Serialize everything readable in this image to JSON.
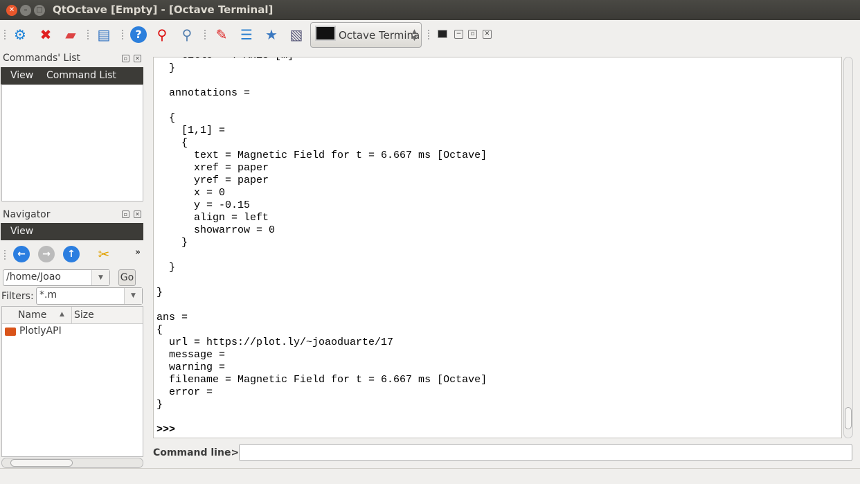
{
  "window": {
    "title": "QtOctave [Empty] - [Octave Terminal]"
  },
  "toolbar": {
    "icons": [
      "settings-icon",
      "stop-icon",
      "clear-icon",
      "table-icon",
      "help-icon",
      "search-help-icon",
      "search-icon",
      "editor-icon",
      "list-icon",
      "open-folder-icon",
      "notes-icon"
    ],
    "window_selector": "Octave Termina"
  },
  "commands_list": {
    "title": "Commands' List",
    "menu": [
      "View",
      "Command List"
    ]
  },
  "navigator": {
    "title": "Navigator",
    "menu": [
      "View"
    ],
    "more": "»",
    "path": "/home/Joao",
    "go": "Go",
    "filters_label": "Filters:",
    "filter": "*.m",
    "columns": [
      "Name",
      "Size"
    ],
    "files": [
      {
        "name": "PlotlyAPI",
        "type": "folder"
      }
    ]
  },
  "terminal": {
    "lines": [
      "    title = Y Axis [m]",
      "  }",
      "",
      "  annotations =",
      "",
      "  {",
      "    [1,1] =",
      "    {",
      "      text = Magnetic Field for t = 6.667 ms [Octave]",
      "      xref = paper",
      "      yref = paper",
      "      x = 0",
      "      y = -0.15",
      "      align = left",
      "      showarrow = 0",
      "    }",
      "",
      "  }",
      "",
      "}",
      "",
      "ans =",
      "{",
      "  url = https://plot.ly/~joaoduarte/17",
      "  message =",
      "  warning =",
      "  filename = Magnetic Field for t = 6.667 ms [Octave]",
      "  error =",
      "}",
      "",
      ">>>"
    ]
  },
  "command_line": {
    "label": "Command line>>",
    "value": ""
  }
}
